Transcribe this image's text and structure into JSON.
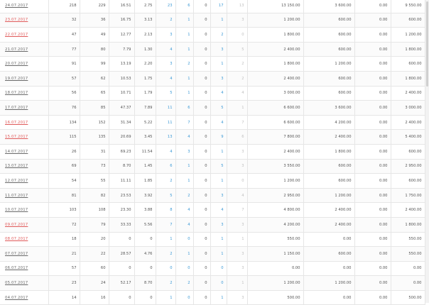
{
  "table": {
    "rows": [
      {
        "date": "24.07.2017",
        "weekend": false,
        "c1": "218",
        "c2": "229",
        "c3": "16.51",
        "c4": "2.75",
        "c5": "23",
        "c6": "6",
        "c7": "0",
        "c8": "17",
        "c9": "13",
        "c10": "13 150.00",
        "c11": "3 600.00",
        "c12": "0.00",
        "c13": "9 550.00"
      },
      {
        "date": "23.07.2017",
        "weekend": true,
        "c1": "32",
        "c2": "36",
        "c3": "16.75",
        "c4": "3.13",
        "c5": "2",
        "c6": "1",
        "c7": "0",
        "c8": "1",
        "c9": "3",
        "c10": "1 200.00",
        "c11": "600.00",
        "c12": "0.00",
        "c13": "600.00"
      },
      {
        "date": "22.07.2017",
        "weekend": true,
        "c1": "47",
        "c2": "49",
        "c3": "12.77",
        "c4": "2.13",
        "c5": "3",
        "c6": "1",
        "c7": "0",
        "c8": "2",
        "c9": "0",
        "c10": "1 800.00",
        "c11": "600.00",
        "c12": "0.00",
        "c13": "1 200.00"
      },
      {
        "date": "21.07.2017",
        "weekend": false,
        "c1": "77",
        "c2": "80",
        "c3": "7.79",
        "c4": "1.30",
        "c5": "4",
        "c6": "1",
        "c7": "0",
        "c8": "3",
        "c9": "5",
        "c10": "2 400.00",
        "c11": "600.00",
        "c12": "0.00",
        "c13": "1 800.00"
      },
      {
        "date": "20.07.2017",
        "weekend": false,
        "c1": "91",
        "c2": "99",
        "c3": "13.19",
        "c4": "2.20",
        "c5": "3",
        "c6": "2",
        "c7": "0",
        "c8": "1",
        "c9": "2",
        "c10": "1 800.00",
        "c11": "1 200.00",
        "c12": "0.00",
        "c13": "600.00"
      },
      {
        "date": "19.07.2017",
        "weekend": false,
        "c1": "57",
        "c2": "62",
        "c3": "10.53",
        "c4": "1.75",
        "c5": "4",
        "c6": "1",
        "c7": "0",
        "c8": "3",
        "c9": "2",
        "c10": "2 400.00",
        "c11": "600.00",
        "c12": "0.00",
        "c13": "1 800.00"
      },
      {
        "date": "18.07.2017",
        "weekend": false,
        "c1": "56",
        "c2": "65",
        "c3": "10.71",
        "c4": "1.79",
        "c5": "5",
        "c6": "1",
        "c7": "0",
        "c8": "4",
        "c9": "4",
        "c10": "3 000.00",
        "c11": "600.00",
        "c12": "0.00",
        "c13": "2 400.00"
      },
      {
        "date": "17.07.2017",
        "weekend": false,
        "c1": "76",
        "c2": "85",
        "c3": "47.37",
        "c4": "7.89",
        "c5": "11",
        "c6": "6",
        "c7": "0",
        "c8": "5",
        "c9": "1",
        "c10": "6 600.00",
        "c11": "3 600.00",
        "c12": "0.00",
        "c13": "3 000.00"
      },
      {
        "date": "16.07.2017",
        "weekend": true,
        "c1": "134",
        "c2": "152",
        "c3": "31.34",
        "c4": "5.22",
        "c5": "11",
        "c6": "7",
        "c7": "0",
        "c8": "4",
        "c9": "7",
        "c10": "6 600.00",
        "c11": "4 200.00",
        "c12": "0.00",
        "c13": "2 400.00"
      },
      {
        "date": "15.07.2017",
        "weekend": true,
        "c1": "115",
        "c2": "135",
        "c3": "20.69",
        "c4": "3.45",
        "c5": "13",
        "c6": "4",
        "c7": "0",
        "c8": "9",
        "c9": "6",
        "c10": "7 800.00",
        "c11": "2 400.00",
        "c12": "0.00",
        "c13": "5 400.00"
      },
      {
        "date": "14.07.2017",
        "weekend": false,
        "c1": "26",
        "c2": "31",
        "c3": "69.23",
        "c4": "11.54",
        "c5": "4",
        "c6": "3",
        "c7": "0",
        "c8": "1",
        "c9": "3",
        "c10": "2 400.00",
        "c11": "1 800.00",
        "c12": "0.00",
        "c13": "600.00"
      },
      {
        "date": "13.07.2017",
        "weekend": false,
        "c1": "69",
        "c2": "73",
        "c3": "8.70",
        "c4": "1.45",
        "c5": "6",
        "c6": "1",
        "c7": "0",
        "c8": "5",
        "c9": "3",
        "c10": "3 550.00",
        "c11": "600.00",
        "c12": "0.00",
        "c13": "2 950.00"
      },
      {
        "date": "12.07.2017",
        "weekend": false,
        "c1": "54",
        "c2": "55",
        "c3": "11.11",
        "c4": "1.85",
        "c5": "2",
        "c6": "1",
        "c7": "0",
        "c8": "1",
        "c9": "0",
        "c10": "1 200.00",
        "c11": "600.00",
        "c12": "0.00",
        "c13": "600.00"
      },
      {
        "date": "11.07.2017",
        "weekend": false,
        "c1": "81",
        "c2": "82",
        "c3": "23.53",
        "c4": "3.92",
        "c5": "5",
        "c6": "2",
        "c7": "0",
        "c8": "3",
        "c9": "4",
        "c10": "2 950.00",
        "c11": "1 200.00",
        "c12": "0.00",
        "c13": "1 750.00"
      },
      {
        "date": "10.07.2017",
        "weekend": false,
        "c1": "103",
        "c2": "108",
        "c3": "23.30",
        "c4": "3.88",
        "c5": "8",
        "c6": "4",
        "c7": "0",
        "c8": "4",
        "c9": "7",
        "c10": "4 800.00",
        "c11": "2 400.00",
        "c12": "0.00",
        "c13": "2 400.00"
      },
      {
        "date": "09.07.2017",
        "weekend": true,
        "c1": "72",
        "c2": "79",
        "c3": "33.33",
        "c4": "5.56",
        "c5": "7",
        "c6": "4",
        "c7": "0",
        "c8": "3",
        "c9": "3",
        "c10": "4 200.00",
        "c11": "2 400.00",
        "c12": "0.00",
        "c13": "1 800.00"
      },
      {
        "date": "08.07.2017",
        "weekend": true,
        "c1": "18",
        "c2": "20",
        "c3": "0",
        "c4": "0",
        "c5": "1",
        "c6": "0",
        "c7": "0",
        "c8": "1",
        "c9": "1",
        "c10": "550.00",
        "c11": "0.00",
        "c12": "0.00",
        "c13": "550.00"
      },
      {
        "date": "07.07.2017",
        "weekend": false,
        "c1": "21",
        "c2": "22",
        "c3": "28.57",
        "c4": "4.76",
        "c5": "2",
        "c6": "1",
        "c7": "0",
        "c8": "1",
        "c9": "3",
        "c10": "1 150.00",
        "c11": "600.00",
        "c12": "0.00",
        "c13": "550.00"
      },
      {
        "date": "06.07.2017",
        "weekend": false,
        "c1": "57",
        "c2": "60",
        "c3": "0",
        "c4": "0",
        "c5": "0",
        "c6": "0",
        "c7": "0",
        "c8": "0",
        "c9": "3",
        "c10": "0.00",
        "c11": "0.00",
        "c12": "0.00",
        "c13": "0.00"
      },
      {
        "date": "05.07.2017",
        "weekend": false,
        "c1": "23",
        "c2": "24",
        "c3": "52.17",
        "c4": "8.70",
        "c5": "2",
        "c6": "2",
        "c7": "0",
        "c8": "0",
        "c9": "1",
        "c10": "1 200.00",
        "c11": "1 200.00",
        "c12": "0.00",
        "c13": "0.00"
      },
      {
        "date": "04.07.2017",
        "weekend": false,
        "c1": "14",
        "c2": "16",
        "c3": "0",
        "c4": "0",
        "c5": "1",
        "c6": "0",
        "c7": "0",
        "c8": "1",
        "c9": "3",
        "c10": "500.00",
        "c11": "0.00",
        "c12": "0.00",
        "c13": "500.00"
      }
    ]
  }
}
